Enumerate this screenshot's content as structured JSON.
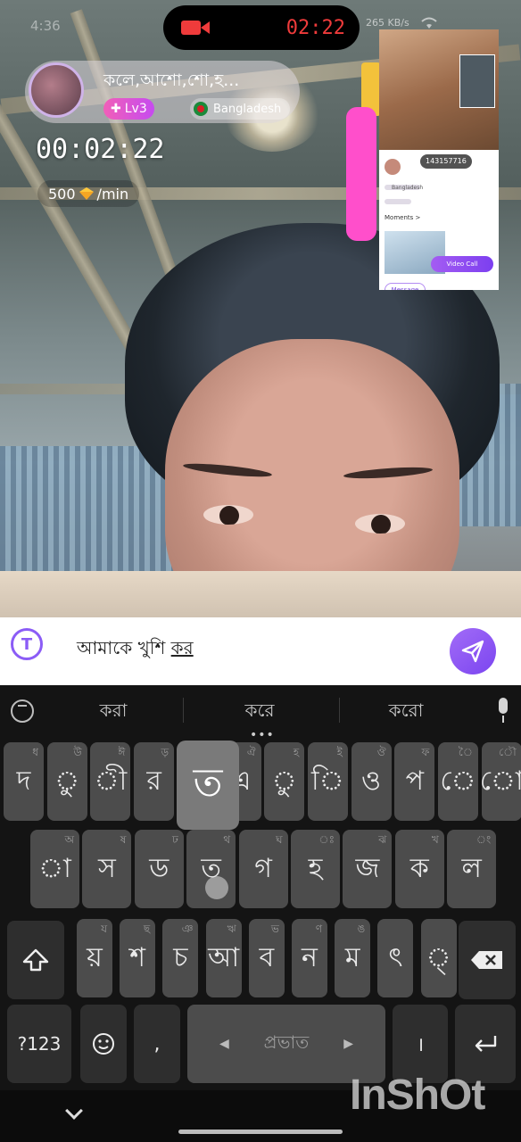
{
  "status_bar": {
    "left_time": "4:36",
    "call_timer": "02:22",
    "net_speed": "265 KB/s"
  },
  "host": {
    "name": "কলে,আশো,শো,হ...",
    "level": "Lv3",
    "country": "Bangladesh",
    "elapsed": "00:02:22",
    "rate": "500",
    "rate_unit": "/min"
  },
  "pip": {
    "user_id": "143157716",
    "country": "Bangladesh",
    "moments_label": "Moments >",
    "message_label": "Message",
    "video_call_label": "Video Call"
  },
  "composer": {
    "text_prefix": "আমাকে খুশি ",
    "text_composing": "কর"
  },
  "keyboard": {
    "suggestions": [
      "করা",
      "করে",
      "করো"
    ],
    "row1": [
      {
        "k": "দ",
        "h": "ধ"
      },
      {
        "k": "ু",
        "h": "উ"
      },
      {
        "k": "ী",
        "h": "ঈ"
      },
      {
        "k": "র",
        "h": "ড়"
      },
      {
        "k": "ত",
        "h": ""
      },
      {
        "k": "এ",
        "h": "ঐ"
      },
      {
        "k": "ু",
        "h": "হ"
      },
      {
        "k": "ি",
        "h": "ই"
      },
      {
        "k": "ও",
        "h": "ঔ"
      },
      {
        "k": "প",
        "h": "ফ"
      },
      {
        "k": "ে",
        "h": "ৈ"
      },
      {
        "k": "ো",
        "h": "ৌ"
      }
    ],
    "row2": [
      {
        "k": "া",
        "h": "অ"
      },
      {
        "k": "স",
        "h": "ষ"
      },
      {
        "k": "ড",
        "h": "ঢ"
      },
      {
        "k": "ত",
        "h": "থ"
      },
      {
        "k": "গ",
        "h": "ঘ"
      },
      {
        "k": "হ",
        "h": "ঃ"
      },
      {
        "k": "জ",
        "h": "ঝ"
      },
      {
        "k": "ক",
        "h": "খ"
      },
      {
        "k": "ল",
        "h": "ং"
      }
    ],
    "row3": [
      {
        "k": "য়",
        "h": "য"
      },
      {
        "k": "শ",
        "h": "ছ"
      },
      {
        "k": "চ",
        "h": "ঞ"
      },
      {
        "k": "আ",
        "h": "ঋ"
      },
      {
        "k": "ব",
        "h": "ভ"
      },
      {
        "k": "ন",
        "h": "ণ"
      },
      {
        "k": "ম",
        "h": "ঙ"
      },
      {
        "k": "ৎ",
        "h": ""
      },
      {
        "k": "্",
        "h": ""
      }
    ],
    "popup_char": "ত",
    "numbers_label": "?123",
    "comma": ",",
    "space_label": "প্রভাত",
    "danda": "।"
  },
  "watermark": "InShOt",
  "colors": {
    "accent": "#8b5cf6",
    "timer_red": "#ef3b3b",
    "level_pink": "#f15fb8",
    "pip_accent": "#ff4fcb"
  },
  "icons": [
    "camera-icon",
    "wifi-icon",
    "diamond-icon",
    "translate-icon",
    "send-icon",
    "clipboard-icon",
    "mic-icon",
    "shift-icon",
    "backspace-icon",
    "emoji-icon",
    "enter-icon",
    "nav-chevron-icon"
  ]
}
